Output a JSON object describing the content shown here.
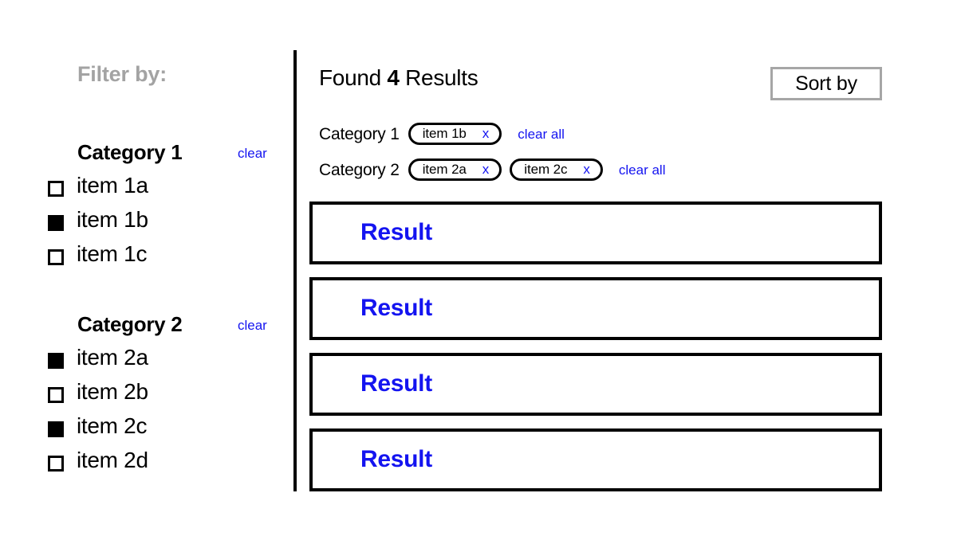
{
  "sidebar": {
    "heading": "Filter by:",
    "groups": [
      {
        "title": "Category 1",
        "clear_label": "clear",
        "options": [
          {
            "label": "item 1a",
            "checked": false
          },
          {
            "label": "item 1b",
            "checked": true
          },
          {
            "label": "item 1c",
            "checked": false
          }
        ]
      },
      {
        "title": "Category 2",
        "clear_label": "clear",
        "options": [
          {
            "label": "item 2a",
            "checked": true
          },
          {
            "label": "item 2b",
            "checked": false
          },
          {
            "label": "item 2c",
            "checked": true
          },
          {
            "label": "item 2d",
            "checked": false
          }
        ]
      }
    ]
  },
  "content": {
    "results_found_prefix": "Found ",
    "results_count": "4",
    "results_found_suffix": " Results",
    "sort_by_label": "Sort by",
    "applied_filters": [
      {
        "label": "Category 1",
        "clear_all_label": "clear all",
        "chips": [
          {
            "label": "item 1b",
            "remove_icon": "x"
          }
        ]
      },
      {
        "label": "Category 2",
        "clear_all_label": "clear all",
        "chips": [
          {
            "label": "item 2a",
            "remove_icon": "x"
          },
          {
            "label": "item 2c",
            "remove_icon": "x"
          }
        ]
      }
    ],
    "results": [
      {
        "title": "Result"
      },
      {
        "title": "Result"
      },
      {
        "title": "Result"
      },
      {
        "title": "Result"
      }
    ]
  },
  "colors": {
    "link_blue": "#1414f0",
    "heading_gray": "#a3a3a3",
    "border_black": "#000000",
    "button_border_gray": "#a6a6a6"
  }
}
